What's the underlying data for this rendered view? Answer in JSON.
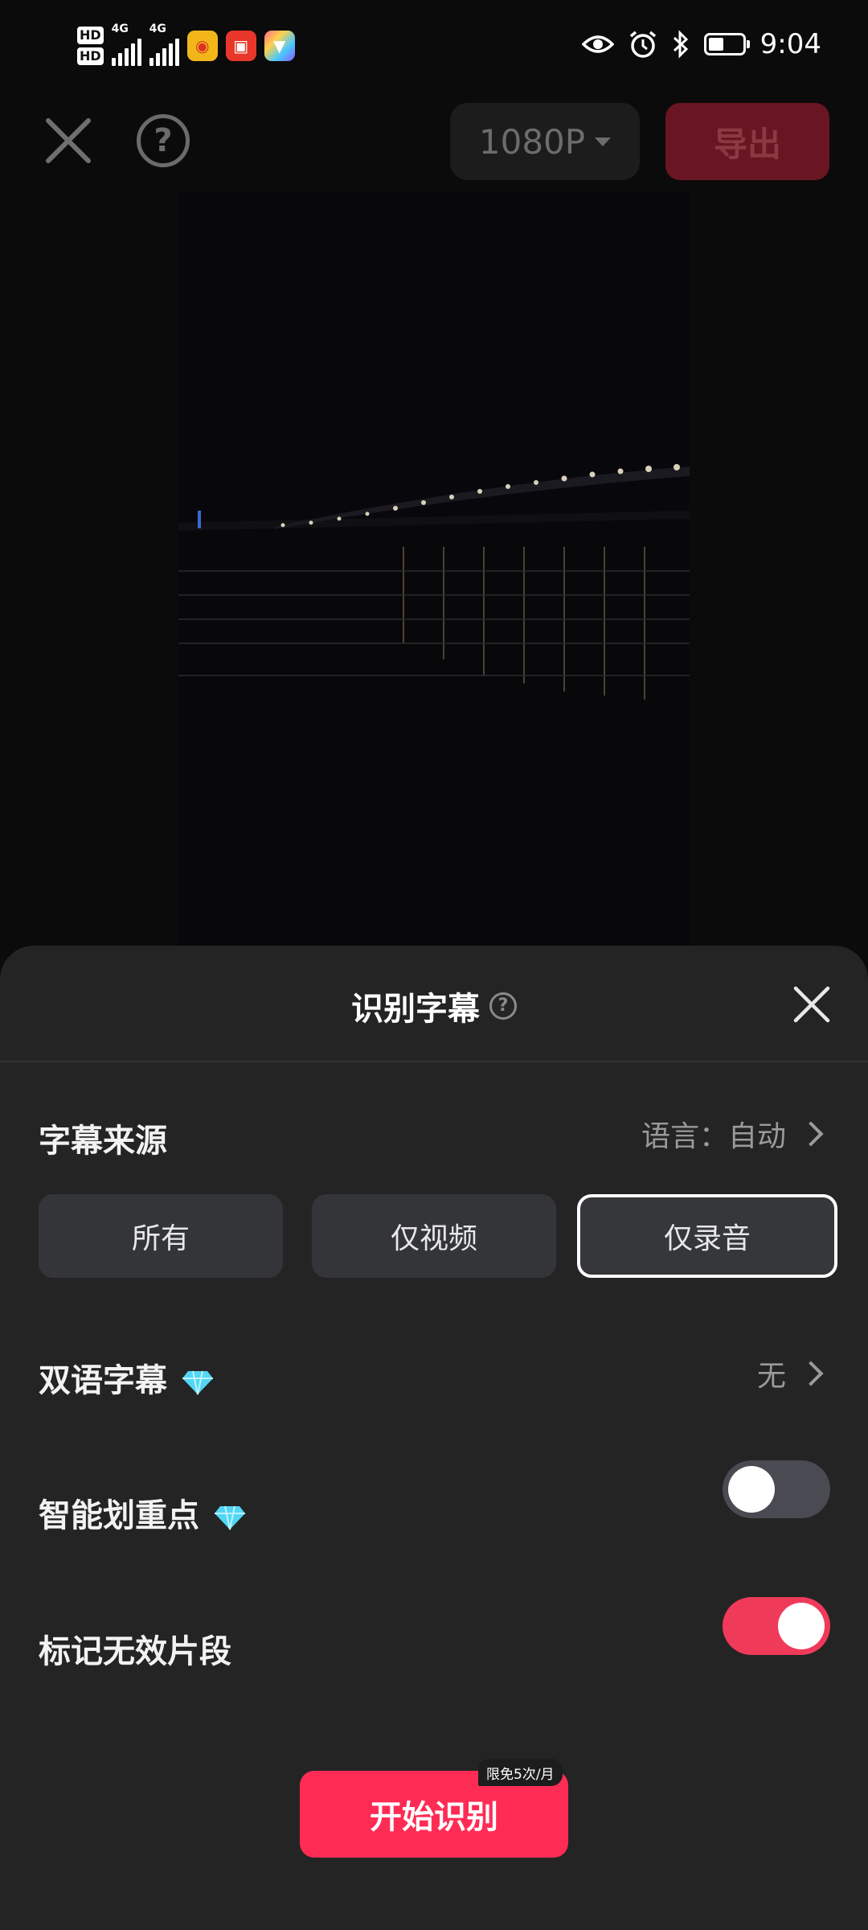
{
  "status_bar": {
    "hd1": "HD",
    "hd2": "HD",
    "net1": "4G",
    "net2": "4G",
    "time": "9:04",
    "icons": [
      "eye-icon",
      "alarm-icon",
      "bluetooth-icon",
      "battery-icon"
    ],
    "apps": [
      "weibo-icon",
      "app-icon-2",
      "app-icon-3"
    ]
  },
  "toolbar": {
    "resolution": "1080P",
    "export_label": "导出"
  },
  "panel": {
    "title": "识别字幕",
    "subtitle_source": {
      "label": "字幕来源",
      "language": "语言：自动",
      "options": [
        "所有",
        "仅视频",
        "仅录音"
      ],
      "selected": "仅录音"
    },
    "bilingual": {
      "label": "双语字幕",
      "value": "无"
    },
    "smart_highlight": {
      "label": "智能划重点",
      "enabled": false
    },
    "mark_invalid": {
      "label": "标记无效片段",
      "enabled": true
    },
    "start_button": "开始识别",
    "quota_badge": "限免5次/月"
  },
  "colors": {
    "accent": "#fe2c55",
    "panel_bg": "#242424",
    "gem": "#4fd8f0"
  }
}
